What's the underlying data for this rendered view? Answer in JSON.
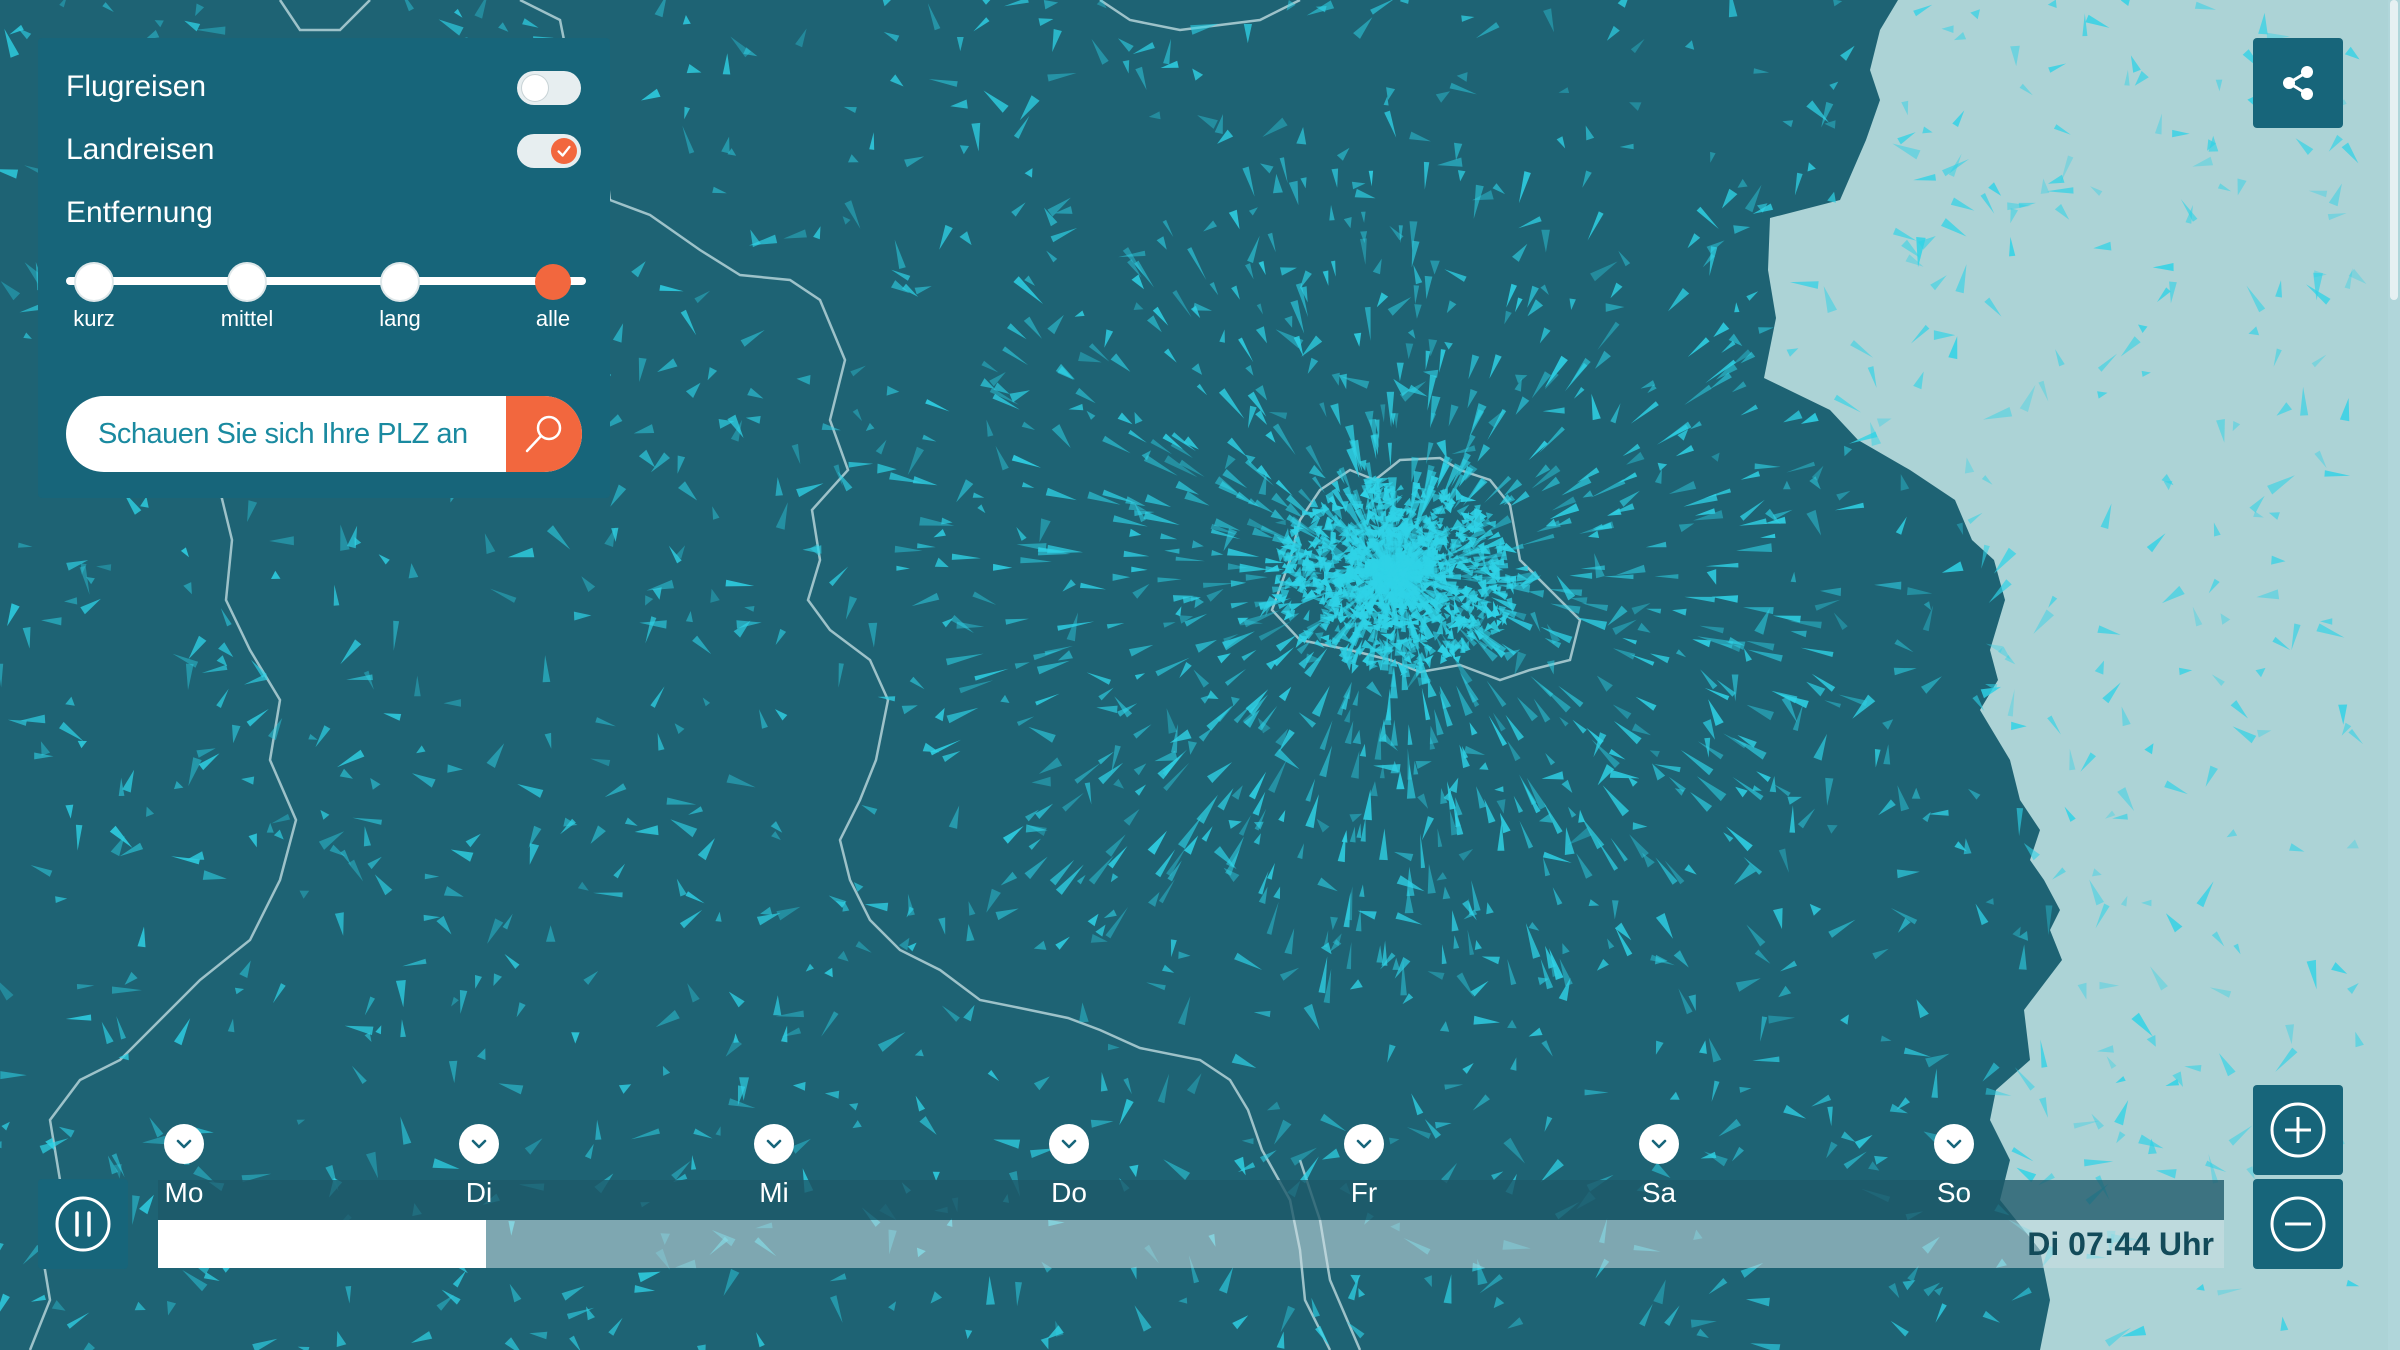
{
  "colors": {
    "map_land": "#1e6374",
    "map_outside": "#acd3d6",
    "particles": "#2fd2e6",
    "panel": "#17657a",
    "accent": "#f2673e"
  },
  "filters": {
    "flights_label": "Flugreisen",
    "flights_on": false,
    "land_label": "Landreisen",
    "land_on": true,
    "distance_label": "Entfernung",
    "distance_options": [
      "kurz",
      "mittel",
      "lang",
      "alle"
    ],
    "distance_selected": "alle"
  },
  "search": {
    "placeholder": "Schauen Sie sich Ihre PLZ an",
    "button_icon": "search-icon"
  },
  "controls": {
    "share_icon": "share-icon",
    "zoom_in_icon": "plus-icon",
    "zoom_out_icon": "minus-icon",
    "pause_icon": "pause-icon"
  },
  "timeline": {
    "days": [
      "Mo",
      "Di",
      "Mi",
      "Do",
      "Fr",
      "Sa",
      "So"
    ],
    "current_time": "Di 07:44 Uhr",
    "progress": 0.159
  }
}
